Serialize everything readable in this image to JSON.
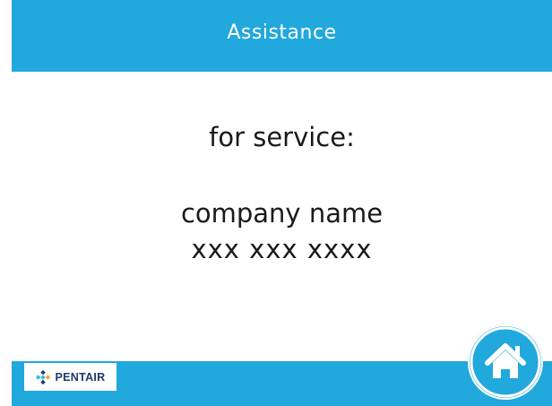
{
  "header": {
    "title": "Assistance"
  },
  "content": {
    "line1": "for service:",
    "line2": "company name",
    "line3": "xxx xxx xxxx"
  },
  "footer": {
    "logo_text": "PENTAIR",
    "home_icon": "home-icon"
  },
  "colors": {
    "accent": "#21a8dc",
    "text": "#1a1a1a",
    "background": "#ffffff"
  }
}
